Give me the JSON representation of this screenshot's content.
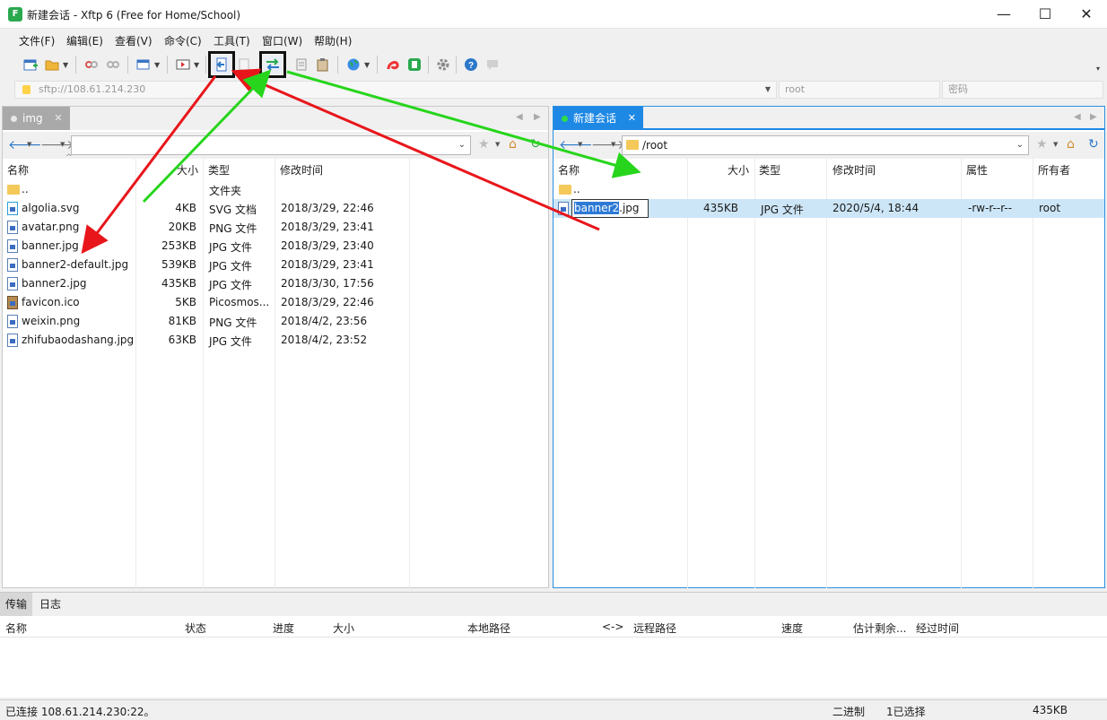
{
  "window": {
    "app_icon_text": "F",
    "title": "新建会话 - Xftp 6 (Free for Home/School)",
    "minimize": "—",
    "maximize": "☐",
    "close": "✕"
  },
  "menu": [
    "文件(F)",
    "编辑(E)",
    "查看(V)",
    "命令(C)",
    "工具(T)",
    "窗口(W)",
    "帮助(H)"
  ],
  "toolbar": {
    "icons": [
      "new-session-icon",
      "open-folder-icon",
      "disconnect-icon",
      "reconnect-icon",
      "new-window-icon",
      "terminal-icon",
      "transfer-to-left-icon",
      "copy-icon",
      "sync-transfer-icon",
      "paste-icon",
      "clipboard-icon",
      "globe-icon",
      "xshell-icon",
      "xftp-icon",
      "settings-icon",
      "help-icon",
      "chat-icon"
    ],
    "overflow": "▾"
  },
  "address": {
    "host": "sftp://108.61.214.230",
    "user": "root",
    "password_placeholder": "密码"
  },
  "left_pane": {
    "tab_label": "img",
    "tab_close": "✕",
    "path": "",
    "columns": [
      "名称",
      "大小",
      "类型",
      "修改时间"
    ],
    "files": [
      {
        "name": "..",
        "size": "",
        "type": "文件夹",
        "modified": "",
        "icon": "folder-icon"
      },
      {
        "name": "algolia.svg",
        "size": "4KB",
        "type": "SVG 文档",
        "modified": "2018/3/29, 22:46",
        "icon": "svg-file-icon"
      },
      {
        "name": "avatar.png",
        "size": "20KB",
        "type": "PNG 文件",
        "modified": "2018/3/29, 23:41",
        "icon": "image-file-icon"
      },
      {
        "name": "banner.jpg",
        "size": "253KB",
        "type": "JPG 文件",
        "modified": "2018/3/29, 23:40",
        "icon": "image-file-icon"
      },
      {
        "name": "banner2-default.jpg",
        "size": "539KB",
        "type": "JPG 文件",
        "modified": "2018/3/29, 23:41",
        "icon": "image-file-icon"
      },
      {
        "name": "banner2.jpg",
        "size": "435KB",
        "type": "JPG 文件",
        "modified": "2018/3/30, 17:56",
        "icon": "image-file-icon"
      },
      {
        "name": "favicon.ico",
        "size": "5KB",
        "type": "Picosmos...",
        "modified": "2018/3/29, 22:46",
        "icon": "ico-file-icon"
      },
      {
        "name": "weixin.png",
        "size": "81KB",
        "type": "PNG 文件",
        "modified": "2018/4/2, 23:56",
        "icon": "image-file-icon"
      },
      {
        "name": "zhifubaodashang.jpg",
        "size": "63KB",
        "type": "JPG 文件",
        "modified": "2018/4/2, 23:52",
        "icon": "image-file-icon"
      }
    ]
  },
  "right_pane": {
    "tab_label": "新建会话",
    "tab_close": "✕",
    "path": "/root",
    "columns": [
      "名称",
      "大小",
      "类型",
      "修改时间",
      "属性",
      "所有者"
    ],
    "files": [
      {
        "name": "..",
        "size": "",
        "type": "",
        "modified": "",
        "attrs": "",
        "owner": ""
      },
      {
        "name_selected": "banner2",
        "name_rest": ".jpg",
        "size": "435KB",
        "type": "JPG 文件",
        "modified": "2020/5/4, 18:44",
        "attrs": "-rw-r--r--",
        "owner": "root"
      }
    ]
  },
  "bottom": {
    "tabs": [
      "传输",
      "日志"
    ],
    "columns": [
      "名称",
      "状态",
      "进度",
      "大小",
      "本地路径",
      "<->",
      "远程路径",
      "速度",
      "估计剩余...",
      "经过时间"
    ]
  },
  "status": {
    "connection": "已连接 108.61.214.230:22。",
    "mode": "二进制",
    "selection": "1已选择",
    "size": "435KB"
  },
  "colors": {
    "accent": "#1e88e5",
    "annotation_red": "#e8161b",
    "annotation_green": "#27d51c",
    "selection": "#cde6f7"
  }
}
